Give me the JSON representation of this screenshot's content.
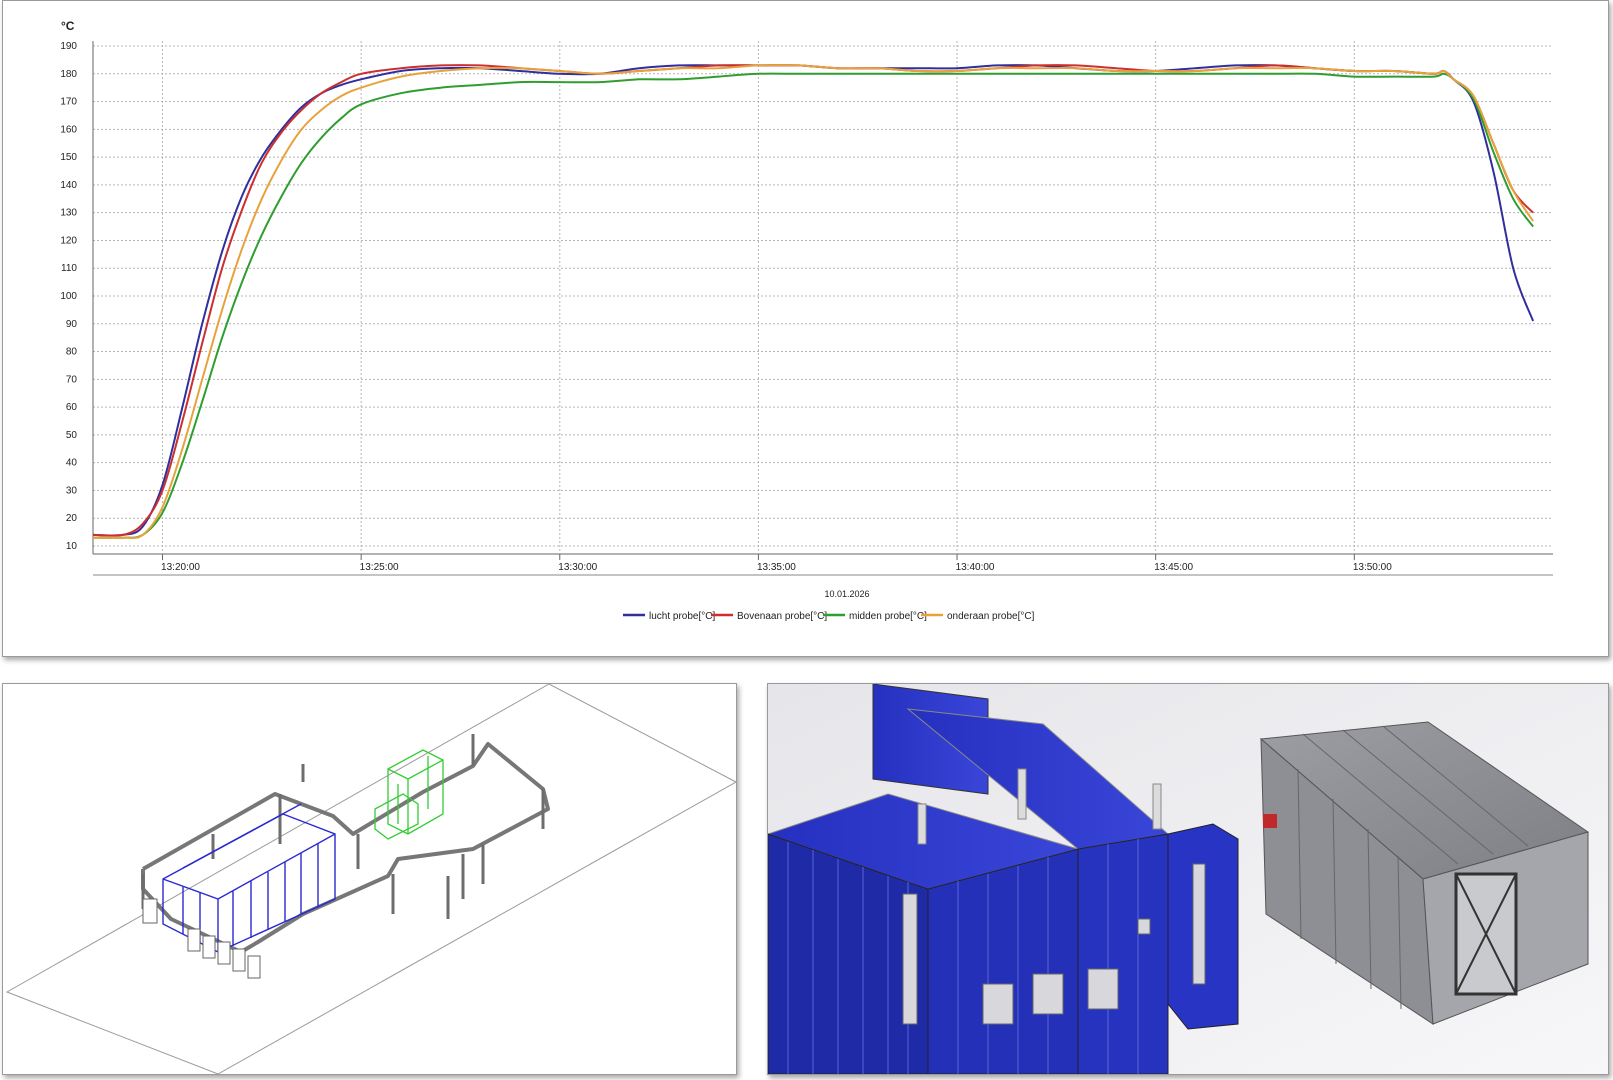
{
  "chart_data": {
    "type": "line",
    "title": "",
    "y_unit": "°C",
    "xlabel": "10.01.2026",
    "ylabel": "",
    "grid": true,
    "legend_position": "bottom-center",
    "ylim": [
      10,
      190
    ],
    "y_ticks": [
      10,
      20,
      30,
      40,
      50,
      60,
      70,
      80,
      90,
      100,
      110,
      120,
      130,
      140,
      150,
      160,
      170,
      180,
      190
    ],
    "xlim": [
      "13:18:15",
      "13:54:45"
    ],
    "x_ticks": [
      "13:20:00",
      "13:25:00",
      "13:30:00",
      "13:35:00",
      "13:40:00",
      "13:45:00",
      "13:50:00"
    ],
    "x": [
      "13:18:15",
      "13:19:00",
      "13:19:30",
      "13:20:00",
      "13:20:30",
      "13:21:00",
      "13:21:30",
      "13:22:00",
      "13:22:30",
      "13:23:00",
      "13:23:30",
      "13:24:00",
      "13:24:30",
      "13:25:00",
      "13:26:00",
      "13:27:00",
      "13:28:00",
      "13:29:00",
      "13:30:00",
      "13:31:00",
      "13:32:00",
      "13:33:00",
      "13:34:00",
      "13:35:00",
      "13:36:00",
      "13:37:00",
      "13:38:00",
      "13:39:00",
      "13:40:00",
      "13:41:00",
      "13:42:00",
      "13:43:00",
      "13:44:00",
      "13:45:00",
      "13:46:00",
      "13:47:00",
      "13:48:00",
      "13:49:00",
      "13:50:00",
      "13:51:00",
      "13:52:00",
      "13:52:15",
      "13:52:30",
      "13:53:00",
      "13:53:30",
      "13:54:00",
      "13:54:30"
    ],
    "series": [
      {
        "name": "lucht probe[°C]",
        "color": "#2f2f9e",
        "values": [
          14,
          14,
          17,
          32,
          60,
          90,
          116,
          136,
          150,
          160,
          168,
          173,
          176,
          178,
          181,
          182,
          182,
          181,
          180,
          180,
          182,
          183,
          183,
          183,
          183,
          182,
          182,
          182,
          182,
          183,
          183,
          182,
          181,
          181,
          182,
          183,
          183,
          182,
          181,
          181,
          180,
          181,
          178,
          170,
          145,
          110,
          91
        ]
      },
      {
        "name": "Bovenaan probe[°C]",
        "color": "#cc2f2f",
        "values": [
          14,
          14,
          18,
          30,
          55,
          83,
          110,
          131,
          148,
          159,
          167,
          173,
          177,
          180,
          182,
          183,
          183,
          182,
          181,
          180,
          181,
          182,
          183,
          183,
          183,
          182,
          182,
          181,
          181,
          182,
          183,
          183,
          182,
          181,
          181,
          182,
          183,
          182,
          181,
          181,
          180,
          181,
          178,
          172,
          155,
          138,
          130
        ]
      },
      {
        "name": "midden probe[°C]",
        "color": "#2f9e2f",
        "values": [
          13,
          13,
          14,
          22,
          40,
          62,
          85,
          105,
          122,
          136,
          148,
          157,
          164,
          169,
          173,
          175,
          176,
          177,
          177,
          177,
          178,
          178,
          179,
          180,
          180,
          180,
          180,
          180,
          180,
          180,
          180,
          180,
          180,
          180,
          180,
          180,
          180,
          180,
          179,
          179,
          179,
          180,
          178,
          171,
          152,
          135,
          125
        ]
      },
      {
        "name": "onderaan probe[°C]",
        "color": "#e8a23c",
        "values": [
          13,
          13,
          14,
          24,
          45,
          70,
          95,
          117,
          135,
          149,
          160,
          167,
          172,
          175,
          179,
          181,
          182,
          182,
          181,
          180,
          181,
          182,
          182,
          183,
          183,
          182,
          182,
          181,
          181,
          182,
          182,
          182,
          181,
          181,
          181,
          182,
          182,
          182,
          181,
          181,
          180,
          181,
          178,
          172,
          155,
          138,
          127
        ]
      }
    ]
  },
  "images": {
    "cad_drawing": {
      "icon": "oven-cad-layout-icon",
      "line_color": "#2a2ad0",
      "highlight_color": "#33cc33"
    },
    "oven_render": {
      "icon": "oven-3d-render-icon",
      "panel_color": "#2a35c8",
      "grey_color": "#8c8e93"
    }
  }
}
